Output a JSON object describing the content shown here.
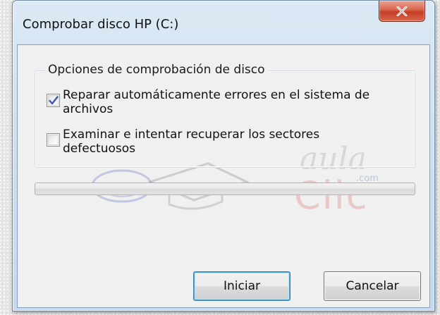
{
  "window": {
    "title": "Comprobar disco HP (C:)",
    "close_icon": "close-x-icon"
  },
  "group": {
    "title": "Opciones de comprobación de disco",
    "options": [
      {
        "label": "Reparar automáticamente errores en el sistema de archivos",
        "checked": true
      },
      {
        "label": "Examinar e intentar recuperar los sectores defectuosos",
        "checked": false
      }
    ]
  },
  "progress": {
    "value_percent": 0
  },
  "buttons": {
    "start_label": "Iniciar",
    "cancel_label": "Cancelar"
  },
  "watermark": {
    "line1": "aula",
    "line2": ".com",
    "line3": "Clic"
  },
  "colors": {
    "titlebar": "#cbdff1",
    "close_button": "#c33d24",
    "client_background": "#f0f0f0",
    "focus_border": "#3c7fb1",
    "checkmark": "#3f5aa8"
  }
}
